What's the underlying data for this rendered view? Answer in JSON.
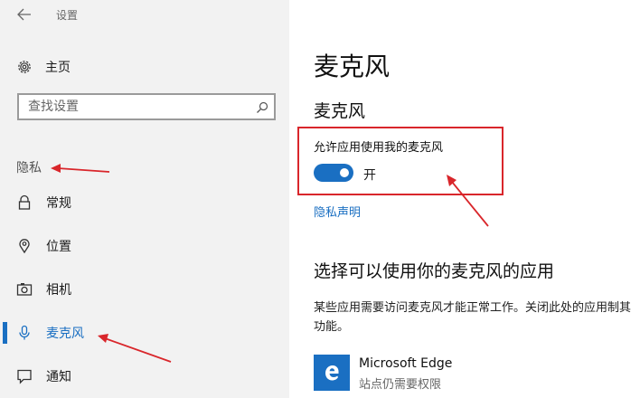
{
  "window": {
    "title": "设置"
  },
  "sidebar": {
    "home_label": "主页",
    "search": {
      "placeholder": "查找设置",
      "value": ""
    },
    "section_label": "隐私",
    "items": [
      {
        "label": "常规",
        "icon": "lock-icon"
      },
      {
        "label": "位置",
        "icon": "location-pin-icon"
      },
      {
        "label": "相机",
        "icon": "camera-icon"
      },
      {
        "label": "麦克风",
        "icon": "microphone-icon",
        "active": true
      },
      {
        "label": "通知",
        "icon": "notification-icon"
      }
    ]
  },
  "main": {
    "title": "麦克风",
    "section_title": "麦克风",
    "allow_label": "允许应用使用我的麦克风",
    "toggle_state": "开",
    "toggle_on": true,
    "privacy_link": "隐私声明",
    "apps_title": "选择可以使用你的麦克风的应用",
    "apps_desc": "某些应用需要访问麦克风才能正常工作。关闭此处的应用制其功能。",
    "apps": [
      {
        "name": "Microsoft Edge",
        "status": "站点仍需要权限",
        "icon": "edge-icon"
      }
    ]
  },
  "colors": {
    "accent": "#1a6fc2",
    "annotation": "#d9262b",
    "sidebar_bg": "#f2f2f2"
  }
}
